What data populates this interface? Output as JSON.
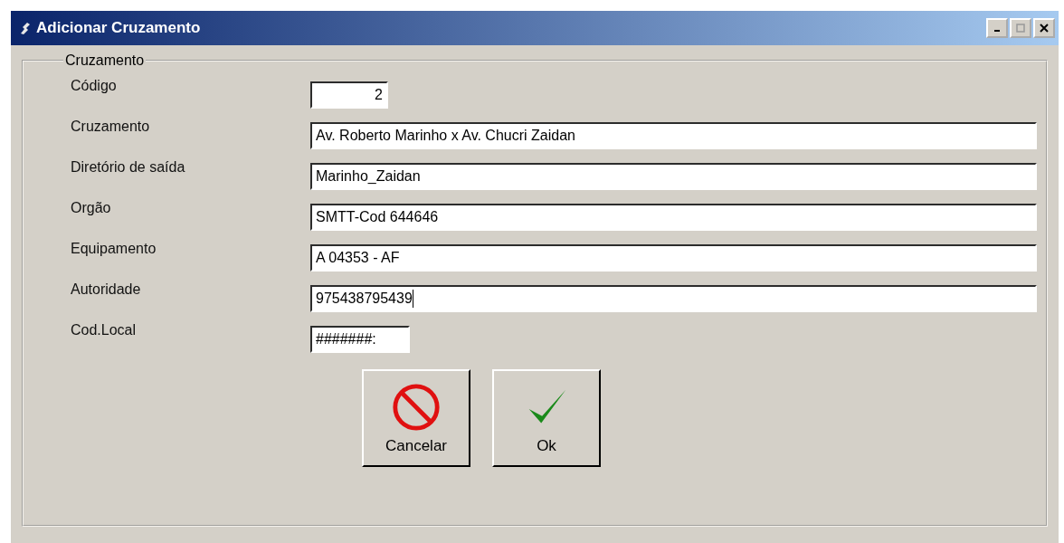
{
  "window": {
    "title": "Adicionar Cruzamento"
  },
  "group": {
    "title": "Cruzamento"
  },
  "fields": [
    {
      "label": "Código",
      "value": "2",
      "kind": "numeric",
      "focused": false
    },
    {
      "label": "Cruzamento",
      "value": "Av. Roberto Marinho x Av. Chucri Zaidan",
      "kind": "text",
      "focused": false
    },
    {
      "label": "Diretório de saída",
      "value": "Marinho_Zaidan",
      "kind": "text",
      "focused": false
    },
    {
      "label": "Orgão",
      "value": "SMTT-Cod 644646",
      "kind": "text",
      "focused": false
    },
    {
      "label": "Equipamento",
      "value": "A 04353 - AF",
      "kind": "text",
      "focused": false
    },
    {
      "label": "Autoridade",
      "value": "975438795439",
      "kind": "text",
      "focused": true
    },
    {
      "label": "Cod.Local",
      "value": "#######:",
      "kind": "code",
      "focused": false
    }
  ],
  "buttons": [
    {
      "label": "Cancelar",
      "kind": "cancel"
    },
    {
      "label": "Ok",
      "kind": "ok"
    }
  ]
}
